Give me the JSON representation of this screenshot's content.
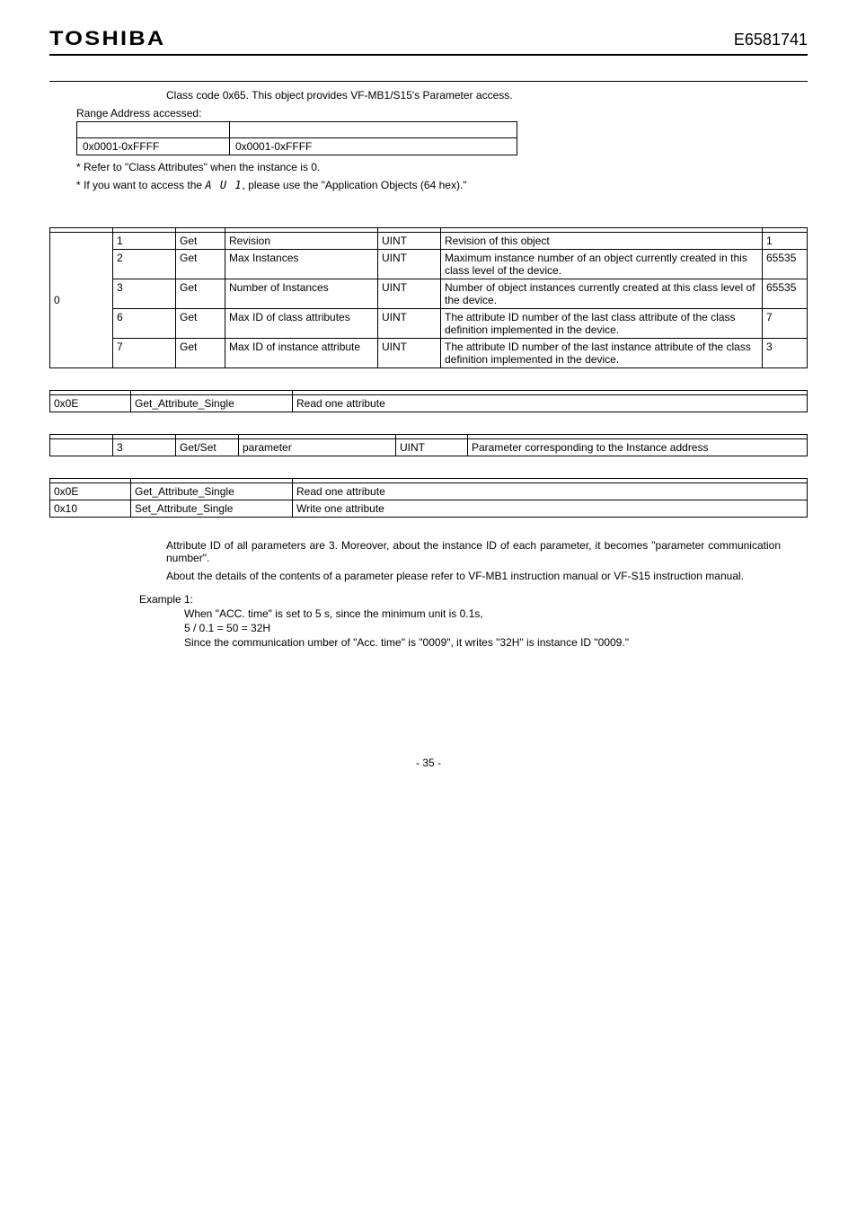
{
  "header": {
    "brand": "TOSHIBA",
    "docno": "E6581741"
  },
  "intro": "Class code 0x65. This object provides VF-MB1/S15's Parameter access.",
  "range_label": "Range Address accessed:",
  "range_table": {
    "r1c1": "",
    "r1c2": "",
    "r2c1": "0x0001-0xFFFF",
    "r2c2": "0x0001-0xFFFF"
  },
  "note1": "* Refer to \"Class Attributes\" when the instance is 0.",
  "note2_pre": "* If you want to access the ",
  "note2_seg": "A U 1",
  "note2_post": ", please use the \"Application Objects (64 hex).\"",
  "class_attr": {
    "inst": "0",
    "rows": [
      {
        "id": "1",
        "rule": "Get",
        "name": "Revision",
        "type": "UINT",
        "desc": "Revision of this object",
        "val": "1"
      },
      {
        "id": "2",
        "rule": "Get",
        "name": "Max Instances",
        "type": "UINT",
        "desc": "Maximum instance number of an object currently created in this class level of the device.",
        "val": "65535"
      },
      {
        "id": "3",
        "rule": "Get",
        "name": "Number of Instances",
        "type": "UINT",
        "desc": "Number of object instances currently created at this class level of the device.",
        "val": "65535"
      },
      {
        "id": "6",
        "rule": "Get",
        "name": "Max ID of class attributes",
        "type": "UINT",
        "desc": "The attribute ID number of the last class attribute of the class definition implemented in the device.",
        "val": "7"
      },
      {
        "id": "7",
        "rule": "Get",
        "name": "Max ID of instance attribute",
        "type": "UINT",
        "desc": "The attribute ID number of the last instance attribute of the class definition implemented in the device.",
        "val": "3"
      }
    ]
  },
  "services_a": {
    "rows": [
      {
        "code": "0x0E",
        "name": "Get_Attribute_Single",
        "desc": "Read one attribute"
      }
    ]
  },
  "inst_attr": {
    "rows": [
      {
        "inst": "",
        "id": "3",
        "rule": "Get/Set",
        "name": "parameter",
        "type": "UINT",
        "desc": "Parameter corresponding to the Instance address"
      }
    ]
  },
  "services_b": {
    "rows": [
      {
        "code": "0x0E",
        "name": "Get_Attribute_Single",
        "desc": "Read one attribute"
      },
      {
        "code": "0x10",
        "name": "Set_Attribute_Single",
        "desc": "Write one attribute"
      }
    ]
  },
  "para1": "Attribute ID of all parameters are 3. Moreover, about the instance ID of each parameter, it becomes \"parameter communication number\".",
  "para2": "About the details of the contents of a parameter please refer to VF-MB1 instruction manual or VF-S15 instruction manual.",
  "example": {
    "head": "Example 1:",
    "l1": "When \"ACC. time\" is set to 5 s, since the minimum unit is 0.1s,",
    "l2": "5 / 0.1 = 50 = 32H",
    "l3": "Since the communication umber of \"Acc. time\" is \"0009\", it writes \"32H\" is instance ID \"0009.\""
  },
  "footer": "- 35 -"
}
